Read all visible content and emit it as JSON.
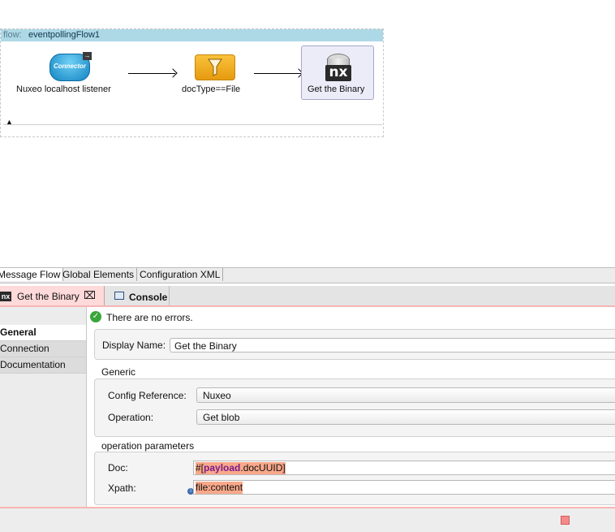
{
  "flow": {
    "prefix": "flow:",
    "name": "eventpollingFlow1",
    "nodes": [
      {
        "label": "Nuxeo localhost listener",
        "icon": "connector-icon",
        "icon_text": "Connector"
      },
      {
        "label": "docType==File",
        "icon": "filter-icon"
      },
      {
        "label": "Get the Binary",
        "icon": "nuxeo-nx-icon",
        "icon_text": "nx"
      }
    ]
  },
  "view_tabs": [
    "Message Flow",
    "Global Elements",
    "Configuration XML"
  ],
  "editor": {
    "active_tab": "Get the Binary",
    "console_tab": "Console",
    "status": "There are no errors.",
    "side_items": [
      "General",
      "Connection",
      "Documentation"
    ],
    "display_name_label": "Display Name:",
    "display_name_value": "Get the Binary",
    "generic_title": "Generic",
    "config_ref_label": "Config Reference:",
    "config_ref_value": "Nuxeo",
    "operation_label": "Operation:",
    "operation_value": "Get blob",
    "op_params_title": "operation parameters",
    "doc_label": "Doc:",
    "doc_value_prefix": "#[",
    "doc_value_keyword": "payload",
    "doc_value_suffix": ".docUUID]",
    "xpath_label": "Xpath:",
    "xpath_value": "file:content"
  },
  "colors": {
    "flow_header": "#add8e6",
    "error_tab_bg": "#ffdada",
    "expression_highlight": "#f9a88a",
    "ok_green": "#3aa53a"
  }
}
